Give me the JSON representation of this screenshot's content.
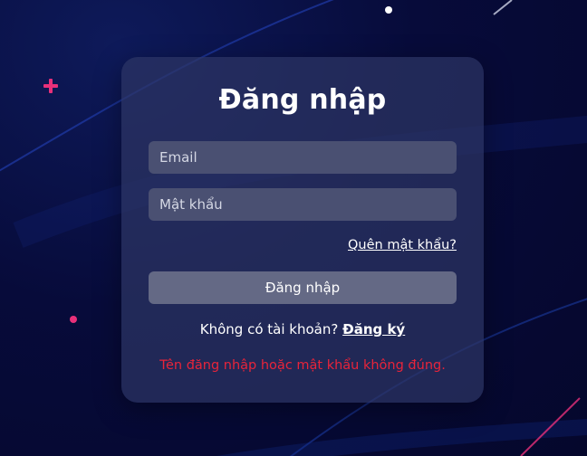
{
  "login": {
    "title": "Đăng nhập",
    "email_placeholder": "Email",
    "password_placeholder": "Mật khẩu",
    "forgot_label": "Quên mật khẩu?",
    "submit_label": "Đăng nhập",
    "no_account_text": "Không có tài khoản?",
    "signup_label": "Đăng ký",
    "error_message": "Tên đăng nhập hoặc mật khẩu không đúng."
  },
  "colors": {
    "background": "#070b3a",
    "card": "#2d3464",
    "input": "#4a5072",
    "button": "#646985",
    "error": "#e8243a",
    "accent_pink": "#e8307a"
  },
  "decor_icons": [
    "plus-sparkle-icon",
    "dot-sparkle-icon",
    "shooting-star-icon"
  ]
}
